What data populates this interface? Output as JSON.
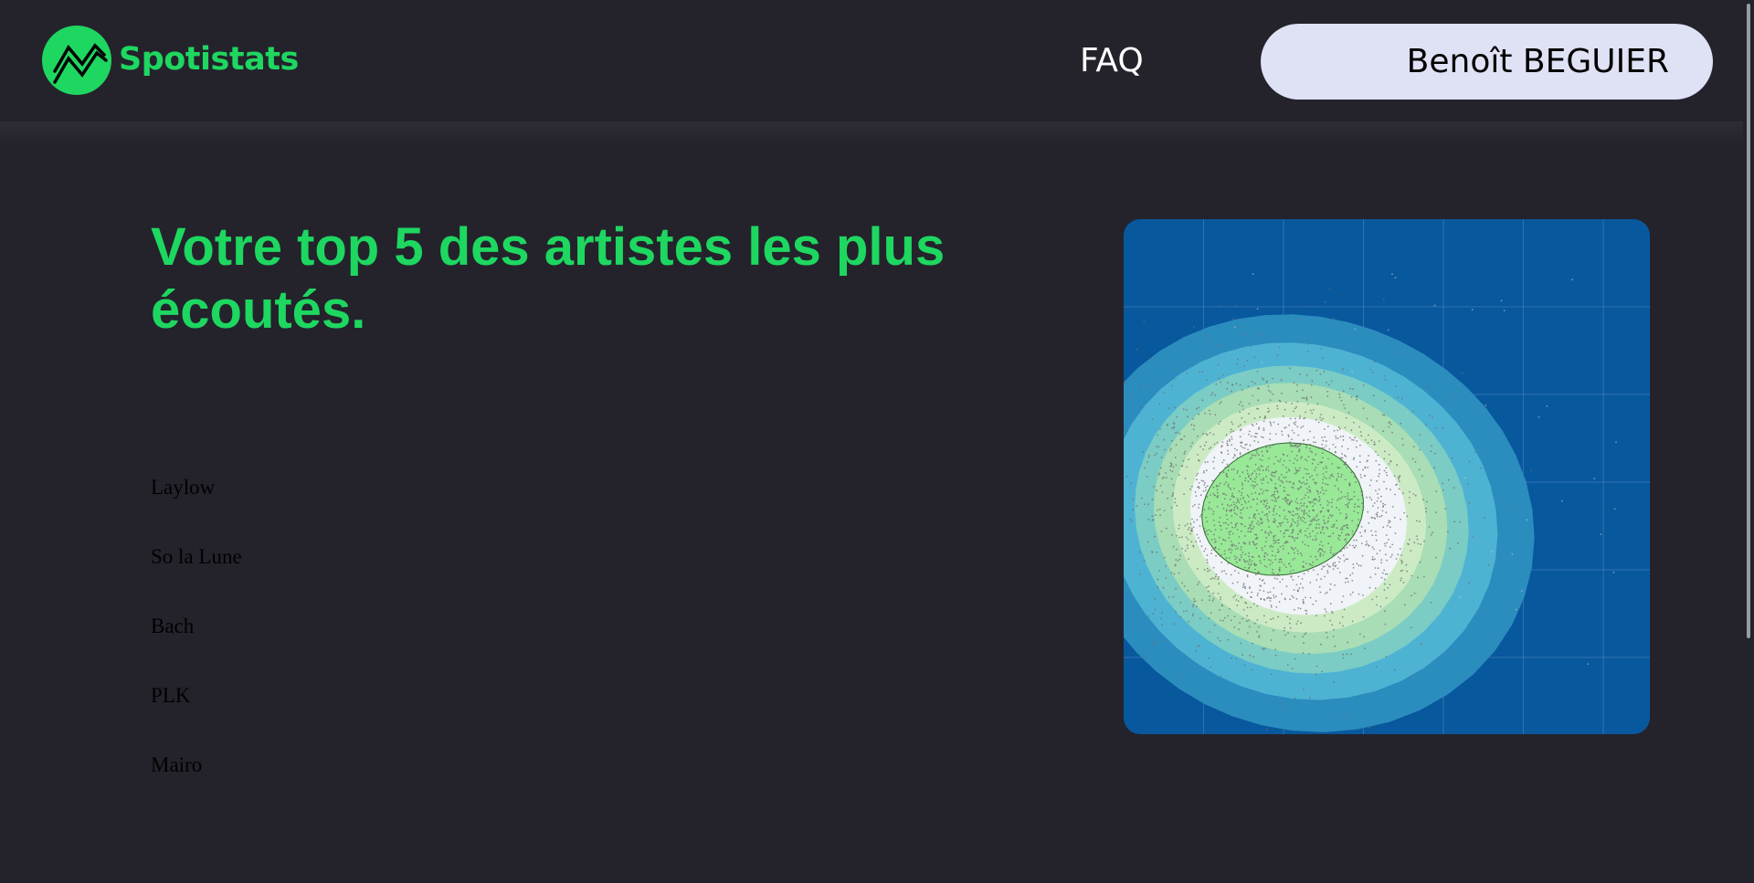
{
  "navbar": {
    "brand": "Spotistats",
    "faq_label": "FAQ",
    "user_name": "Benoît BEGUIER"
  },
  "main": {
    "title": "Votre top 5 des artistes les plus écoutés.",
    "artists": [
      "Laylow",
      "So la Lune",
      "Bach",
      "PLK",
      "Mairo"
    ]
  },
  "colors": {
    "background": "#24232c",
    "accent_green": "#1ed760",
    "user_button": "#dfe1f5",
    "chart_background": "#08589e",
    "density_levels": [
      "#2b8cbe",
      "#4eb3d3",
      "#7bccc4",
      "#a8ddb5",
      "#ccebc5",
      "#f0f3f8"
    ],
    "density_peak": "#98e898"
  },
  "icons": {
    "logo": "trend-line-icon"
  },
  "chart_data": {
    "type": "density_contour",
    "title": "",
    "xlabel": "",
    "ylabel": "",
    "grid": true,
    "levels": 7,
    "peak_location": "left-center",
    "overlay": "scatter-points"
  }
}
